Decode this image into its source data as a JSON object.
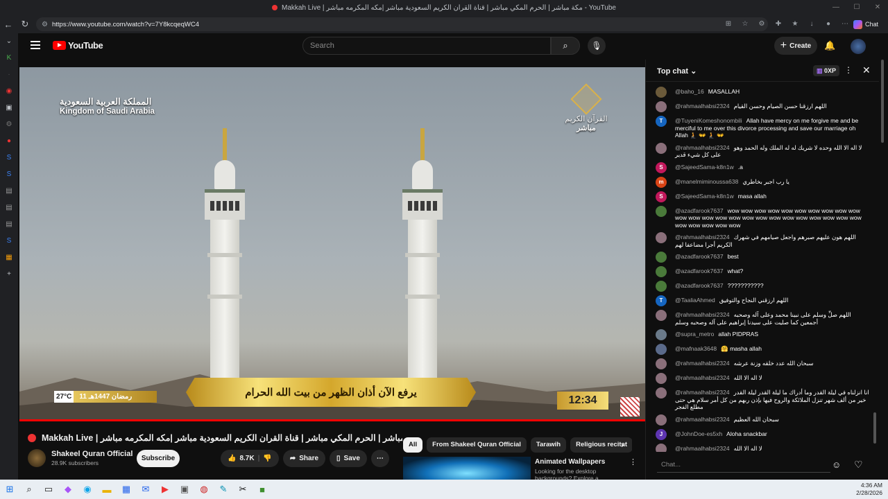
{
  "browser": {
    "window_title": "Makkah Live | مكة مباشر | الحرم المكي مباشر | قناة القران الكريم السعودية مباشر |مكه المكرمه مباشر - YouTube",
    "url": "https://www.youtube.com/watch?v=7Y8kcqeqWC4",
    "chat_label": "Chat"
  },
  "header": {
    "logo_text": "YouTube",
    "search_placeholder": "Search",
    "create_label": "Create"
  },
  "video": {
    "overlay_ksa_ar": "المملكة العربية السعودية",
    "overlay_ksa_en": "Kingdom of Saudi Arabia",
    "overlay_channel_1": "القرآن الكريم",
    "overlay_channel_2": "مباشر",
    "banner_text": "يرفع الآن أذان الظهر من بيت الله الحرام",
    "clock": "12:34",
    "temperature": "27°C",
    "hijri_date": "11 رمضان 1447هـ"
  },
  "info": {
    "title": "Makkah Live | مكة مباشر | الحرم المكي مباشر | قناة القران الكريم السعودية مباشر |مكه المكرمه مباشر",
    "channel": "Shakeel Quran Official",
    "subscribers": "28.9K subscribers",
    "subscribe_label": "Subscribe",
    "likes": "8.7K",
    "share_label": "Share",
    "save_label": "Save"
  },
  "chips": [
    "All",
    "From Shakeel Quran Official",
    "Tarawih",
    "Religious recitat"
  ],
  "recommendation": {
    "title": "Animated Wallpapers",
    "desc": "Looking for the desktop backgrounds? Explore a curated"
  },
  "chat": {
    "title": "Top chat",
    "xp": "0XP",
    "input_placeholder": "Chat...",
    "messages": [
      {
        "author": "@baho_16",
        "text": "MASALLAH",
        "color": "#6b5a3a",
        "initial": ""
      },
      {
        "author": "@rahmaalhabsi2324",
        "text": "اللهم ارزقنا حسن الصيام وحسن القيام",
        "color": "#8a6f7a",
        "initial": ""
      },
      {
        "author": "@TuyeniKomeshonombili",
        "text": "Allah have mercy on me forgive me and be merciful to me over this divorce processing and save our marriage oh Allah 🧎 👐 🧎 👐",
        "color": "#1565c0",
        "initial": "T"
      },
      {
        "author": "@rahmaalhabsi2324",
        "text": "لا اله الا الله وحده لا شريك له له الملك وله الحمد وهو على كل شيء قدير",
        "color": "#8a6f7a",
        "initial": ""
      },
      {
        "author": "@SajeedSama-k8n1w",
        "text": ".a",
        "color": "#c2185b",
        "initial": "S"
      },
      {
        "author": "@manelmiminoussa638",
        "text": "يا رب اجبر بخاطري",
        "color": "#d84315",
        "initial": "m"
      },
      {
        "author": "@SajeedSama-k8n1w",
        "text": "masa allah",
        "color": "#c2185b",
        "initial": "S"
      },
      {
        "author": "@azadfarook7637",
        "text": "wow wow wow wow wow wow wow wow wow wow wow wow wow wow wow wow wow wow wow wow wow wow wow wow wow wow wow wow wow",
        "color": "#4a7a3a",
        "initial": ""
      },
      {
        "author": "@rahmaalhabsi2324",
        "text": "اللهم هون عليهم صبرهم واجعل صيامهم في شهرك الكريم أجرا مضاعفا لهم",
        "color": "#8a6f7a",
        "initial": ""
      },
      {
        "author": "@azadfarook7637",
        "text": "best",
        "color": "#4a7a3a",
        "initial": ""
      },
      {
        "author": "@azadfarook7637",
        "text": "what?",
        "color": "#4a7a3a",
        "initial": ""
      },
      {
        "author": "@azadfarook7637",
        "text": "???????????",
        "color": "#4a7a3a",
        "initial": ""
      },
      {
        "author": "@TaaliaAhmed",
        "text": "اللهم ارزقني النجاح والتوفيق",
        "color": "#1565c0",
        "initial": "T"
      },
      {
        "author": "@rahmaalhabsi2324",
        "text": "اللهم صلِّ وسلم على نبينا محمد وعلى آله وصحبه أجمعين كما صليت على سيدنا إبراهيم على آله وصحبه وسلم",
        "color": "#8a6f7a",
        "initial": ""
      },
      {
        "author": "@supra_metro",
        "text": "allah PIDPRAS",
        "color": "#6a7a8a",
        "initial": ""
      },
      {
        "author": "@mafnaak3648",
        "text": "🤗 masha allah",
        "color": "#5a6a8a",
        "initial": ""
      },
      {
        "author": "@rahmaalhabsi2324",
        "text": "سبحان الله عدد خلقه وزنة عرشه",
        "color": "#8a6f7a",
        "initial": ""
      },
      {
        "author": "@rahmaalhabsi2324",
        "text": "لا اله الا الله",
        "color": "#8a6f7a",
        "initial": ""
      },
      {
        "author": "@rahmaalhabsi2324",
        "text": "انا انزلناه في ليلة القدر وما أدراك ما ليلة القدر ليلة القدر خير من ألف شهر تنزل الملائكة والروح فيها بإذن ربهم من كل أمر سلام هي حتى مطلع الفجر",
        "color": "#8a6f7a",
        "initial": ""
      },
      {
        "author": "@rahmaalhabsi2324",
        "text": "سبحان الله العظيم",
        "color": "#8a6f7a",
        "initial": ""
      },
      {
        "author": "@JohnDoe-es5xh",
        "text": "Aloha snackbar",
        "color": "#5e35b1",
        "initial": "J"
      },
      {
        "author": "@rahmaalhabsi2324",
        "text": "لا اله الا الله",
        "color": "#8a6f7a",
        "initial": ""
      }
    ]
  },
  "taskbar": {
    "time": "4:36 AM",
    "date": "2/28/2026"
  }
}
